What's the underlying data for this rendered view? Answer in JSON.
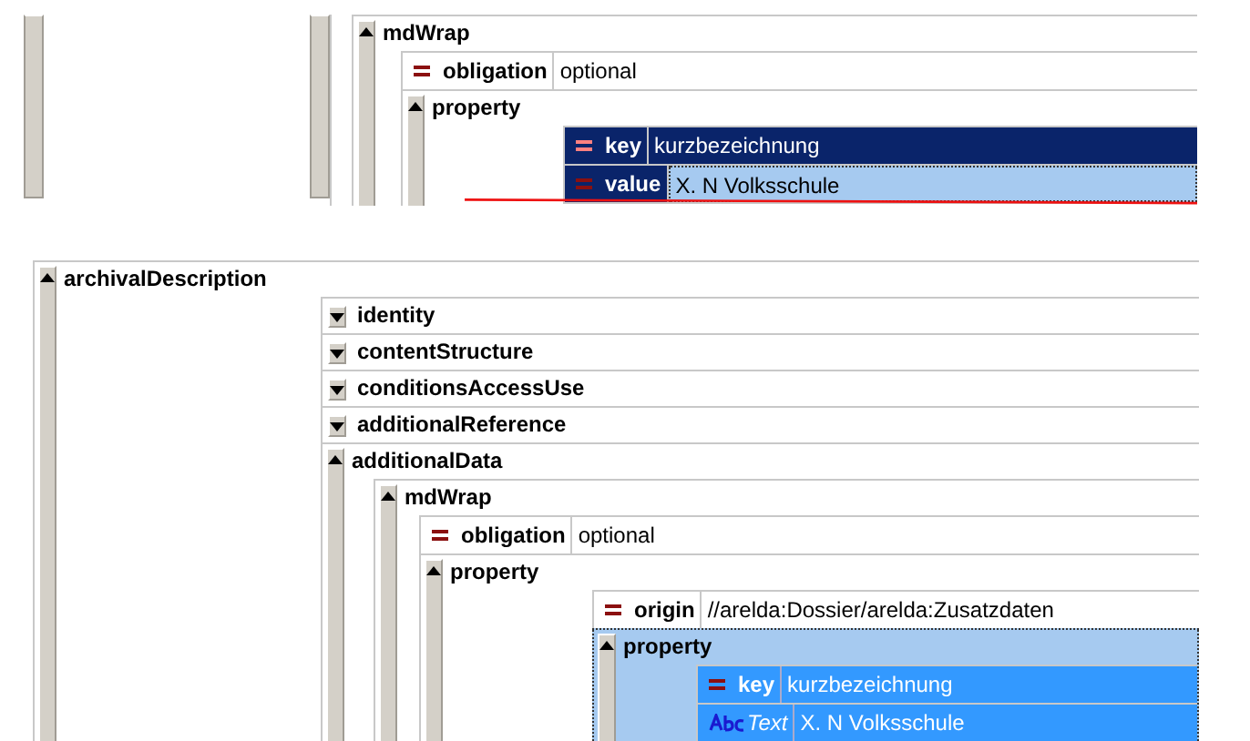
{
  "fragment": {
    "nodes": [
      {
        "kind": "element",
        "name": "mdWrap",
        "expanded": true,
        "selected": false,
        "children": [
          {
            "kind": "attribute",
            "name": "obligation",
            "value": "optional",
            "selected": false,
            "focused": false
          },
          {
            "kind": "element",
            "name": "property",
            "expanded": true,
            "selected": false,
            "children": [
              {
                "kind": "attribute",
                "name": "key",
                "value": "kurzbezeichnung",
                "selected": false,
                "focused": true
              },
              {
                "kind": "attribute",
                "name": "value",
                "value": "X. N Volksschule",
                "selected": true,
                "focused": true
              }
            ]
          }
        ]
      }
    ]
  },
  "tree": {
    "nodes": [
      {
        "kind": "element",
        "name": "archivalDescription",
        "expanded": true,
        "selected": false,
        "children": [
          {
            "kind": "element",
            "name": "identity",
            "expanded": false,
            "selected": false
          },
          {
            "kind": "element",
            "name": "contentStructure",
            "expanded": false,
            "selected": false
          },
          {
            "kind": "element",
            "name": "conditionsAccessUse",
            "expanded": false,
            "selected": false
          },
          {
            "kind": "element",
            "name": "additionalReference",
            "expanded": false,
            "selected": false
          },
          {
            "kind": "element",
            "name": "additionalData",
            "expanded": true,
            "selected": false,
            "children": [
              {
                "kind": "element",
                "name": "mdWrap",
                "expanded": true,
                "selected": false,
                "children": [
                  {
                    "kind": "attribute",
                    "name": "obligation",
                    "value": "optional",
                    "selected": false,
                    "focused": false
                  },
                  {
                    "kind": "element",
                    "name": "property",
                    "expanded": true,
                    "selected": false,
                    "children": [
                      {
                        "kind": "attribute",
                        "name": "origin",
                        "value": "//arelda:Dossier/arelda:Zusatzdaten",
                        "selected": false,
                        "focused": false
                      },
                      {
                        "kind": "element",
                        "name": "property",
                        "expanded": true,
                        "selected": true,
                        "children": [
                          {
                            "kind": "attribute",
                            "name": "key",
                            "value": "kurzbezeichnung",
                            "selected": true,
                            "focused": false
                          },
                          {
                            "kind": "text",
                            "name": "Text",
                            "value": "X. N Volksschule",
                            "selected": true,
                            "focused": false
                          }
                        ]
                      }
                    ]
                  }
                ]
              }
            ]
          }
        ]
      }
    ]
  }
}
